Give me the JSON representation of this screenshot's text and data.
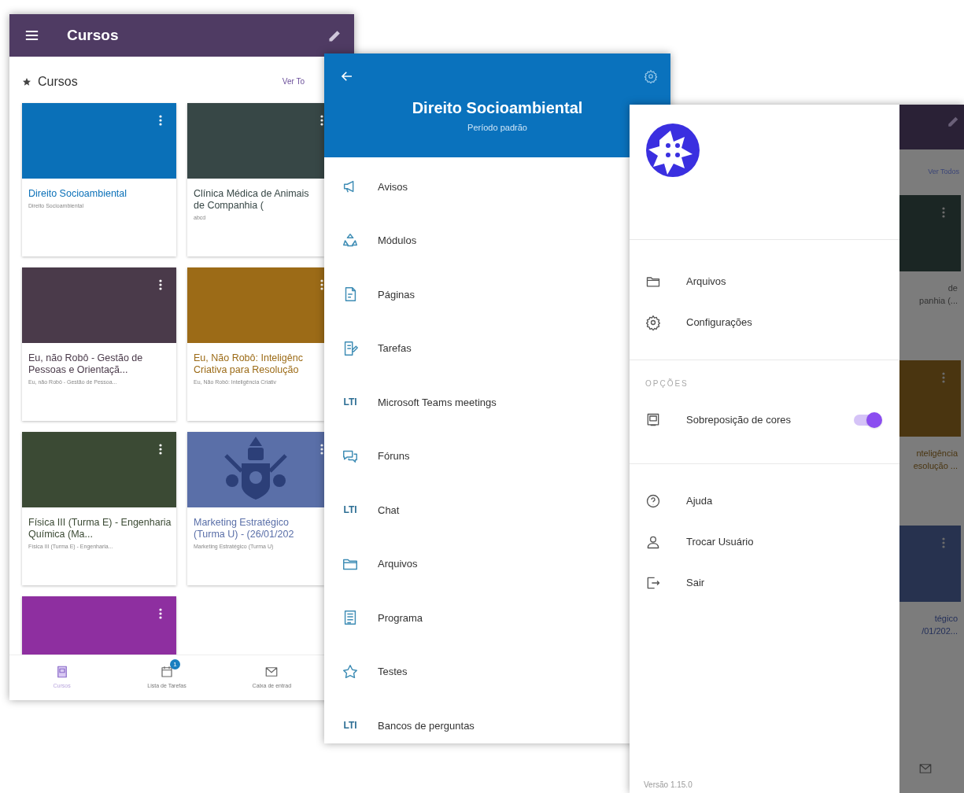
{
  "courses_screen": {
    "title": "Cursos",
    "section_title": "Cursos",
    "view_all": "Ver To",
    "courses": [
      {
        "title": "Direito Socioambiental",
        "subtitle": "Direito Socioambiental",
        "color": "#0a70b8"
      },
      {
        "title": "Clínica Médica de Animais de Companhia (",
        "subtitle": "abcd",
        "color": "#374746"
      },
      {
        "title": "Eu, não Robô - Gestão de Pessoas e Orientaçã...",
        "subtitle": "Eu, não Robô - Gestão de Pessoa...",
        "color": "#4a3a4a"
      },
      {
        "title": "Eu, Não Robô: Inteligênc Criativa para Resolução",
        "subtitle": "Eu, Não Robô: Inteligência Criativ",
        "color": "#9c6b17"
      },
      {
        "title": "Física III (Turma E) - Engenharia Química (Ma...",
        "subtitle": "Física III (Turma E) - Engenharia...",
        "color": "#3b4a34"
      },
      {
        "title": "Marketing Estratégico (Turma U) - (26/01/202",
        "subtitle": "Marketing Estratégico (Turma U)",
        "color": "#5a6fa8",
        "kind": "picture"
      },
      {
        "color": "#8e2fa0"
      }
    ],
    "bottom_nav": [
      {
        "label": "Cursos",
        "selected": true,
        "kind": "courses"
      },
      {
        "label": "Lista de Tarefas",
        "selected": false,
        "kind": "tasks",
        "badge": "1"
      },
      {
        "label": "Caixa de entrad",
        "selected": false,
        "kind": "mail"
      }
    ]
  },
  "course_menu": {
    "title": "Direito Socioambiental",
    "subtitle": "Período padrão",
    "items": [
      {
        "label": "Avisos",
        "kind": "megaphone"
      },
      {
        "label": "Módulos",
        "kind": "modules"
      },
      {
        "label": "Páginas",
        "kind": "page"
      },
      {
        "label": "Tarefas",
        "kind": "task"
      },
      {
        "label": "Microsoft Teams meetings",
        "kind": "lti",
        "icon_text": "LTI"
      },
      {
        "label": "Fóruns",
        "kind": "forum"
      },
      {
        "label": "Chat",
        "kind": "lti",
        "icon_text": "LTI"
      },
      {
        "label": "Arquivos",
        "kind": "folder"
      },
      {
        "label": "Programa",
        "kind": "syllabus"
      },
      {
        "label": "Testes",
        "kind": "quiz"
      },
      {
        "label": "Bancos de perguntas",
        "kind": "lti",
        "icon_text": "LTI"
      }
    ]
  },
  "main_menu": {
    "items": [
      {
        "label": "Arquivos",
        "kind": "folder"
      },
      {
        "label": "Configurações",
        "kind": "gear"
      }
    ],
    "options_title": "OPÇÕES",
    "options": [
      {
        "label": "Sobreposição de cores",
        "kind": "monitor",
        "on": true
      }
    ],
    "account_items": [
      {
        "label": "Ajuda",
        "kind": "help"
      },
      {
        "label": "Trocar Usuário",
        "kind": "user"
      },
      {
        "label": "Sair",
        "kind": "logout"
      }
    ],
    "version": "Versão 1.15.0"
  },
  "background_fragments": {
    "view_all": "Ver Todos",
    "texts": [
      {
        "text": "de",
        "kind": "title"
      },
      {
        "text": "panhia (...",
        "kind": "title"
      },
      {
        "text": "nteligência",
        "kind": "accent"
      },
      {
        "text": "esolução ...",
        "kind": "accent"
      },
      {
        "text": "tégico",
        "kind": "blue"
      },
      {
        "text": "/01/202...",
        "kind": "blue"
      }
    ]
  }
}
